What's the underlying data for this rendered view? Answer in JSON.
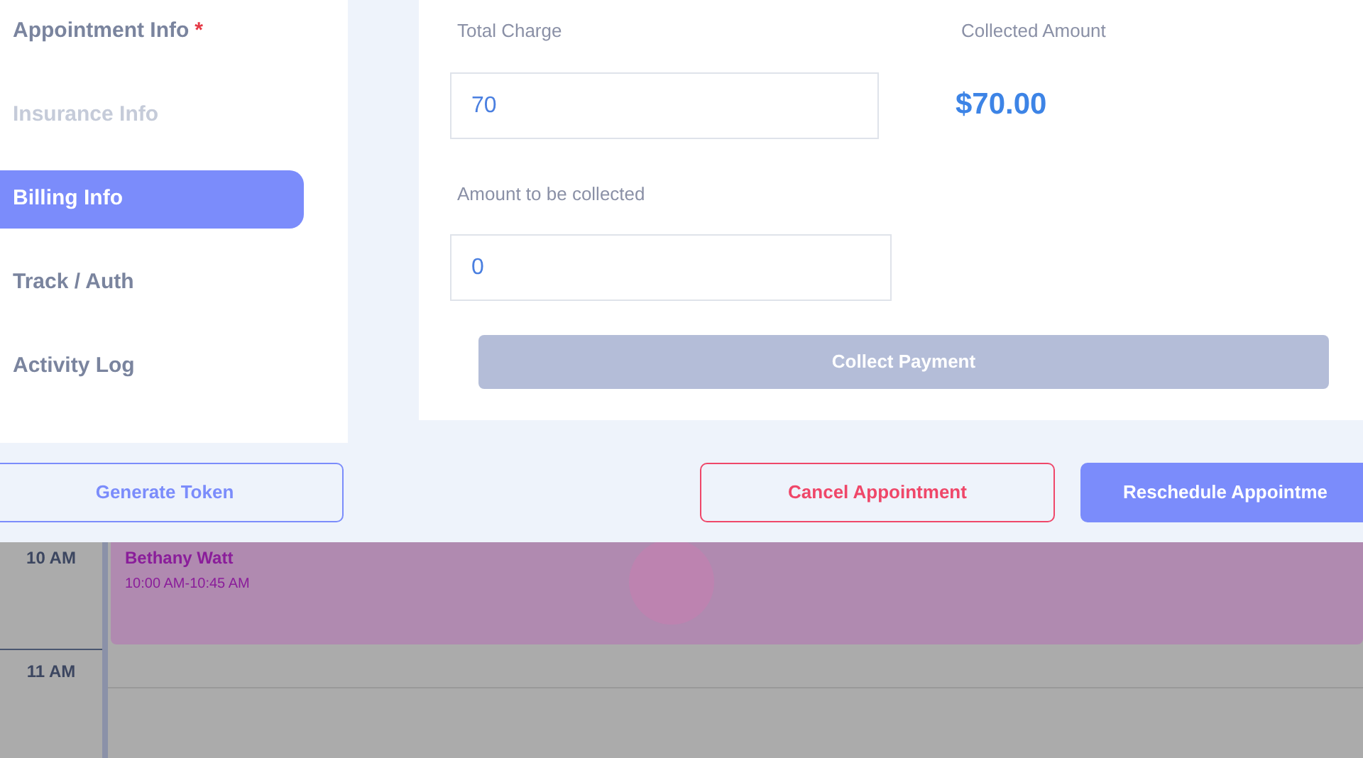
{
  "sidebar": {
    "items": [
      {
        "label": "Appointment Info",
        "required_mark": "*",
        "disabled": false,
        "selected": false
      },
      {
        "label": "Insurance Info",
        "disabled": true,
        "selected": false
      },
      {
        "label": "Billing Info",
        "disabled": false,
        "selected": true
      },
      {
        "label": "Track / Auth",
        "disabled": false,
        "selected": false
      },
      {
        "label": "Activity Log",
        "disabled": false,
        "selected": false
      }
    ]
  },
  "billing": {
    "total_charge": {
      "label": "Total Charge",
      "value": "70"
    },
    "collected_amount": {
      "label": "Collected Amount",
      "value": "$70.00"
    },
    "amount_to_collect": {
      "label": "Amount to be collected",
      "value": "0"
    },
    "collect_button": {
      "label": "Collect Payment",
      "disabled": true
    }
  },
  "footer": {
    "buttons": [
      {
        "label": "Generate Token",
        "kind": "outline"
      },
      {
        "label": "Cancel Appointment",
        "kind": "danger"
      },
      {
        "label": "Reschedule Appointme",
        "kind": "primary"
      }
    ]
  },
  "calendar": {
    "hours": [
      "10 AM",
      "11 AM"
    ],
    "event": {
      "title": "Bethany Watt",
      "time": "10:00 AM-10:45 AM"
    }
  }
}
